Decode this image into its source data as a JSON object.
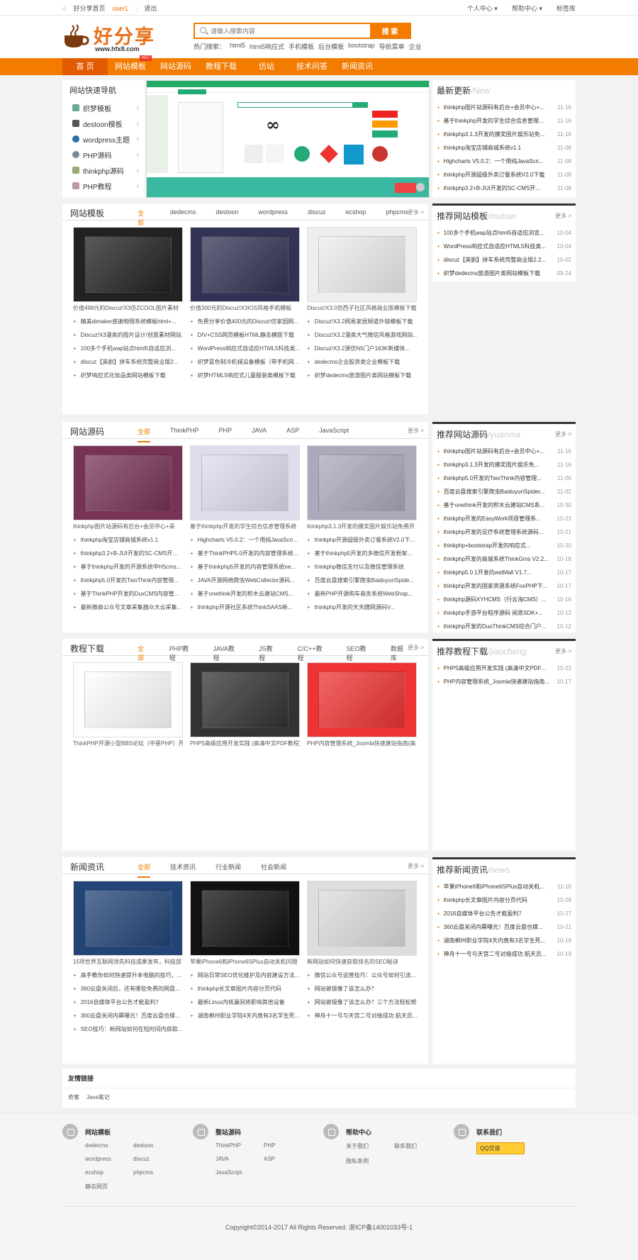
{
  "topbar": {
    "home": "好分享首页",
    "user": "user1",
    "logout": "退出",
    "personal_center": "个人中心",
    "help_center": "帮助中心",
    "bookmark": "标签库"
  },
  "logo": {
    "name": "好分享",
    "url": "www.hfx8.com"
  },
  "search": {
    "placeholder": "请输入搜索内容",
    "button": "搜 索"
  },
  "hot_search": {
    "label": "热门搜索：",
    "items": [
      "html5",
      "html5响应式",
      "手机模板",
      "后台模板",
      "bootstrap",
      "导航菜单",
      "企业"
    ]
  },
  "nav": {
    "items": [
      "首 页",
      "网站模板",
      "网站源码",
      "教程下载",
      "仿站",
      "技术问答",
      "新闻资讯"
    ],
    "hot_badge": "HOT"
  },
  "quick_nav": {
    "title": "网站快速导航",
    "items": [
      "织梦模板",
      "destoon模板",
      "wordpress主题",
      "PHP源码",
      "thinkphp源码",
      "PHP教程"
    ]
  },
  "latest": {
    "title": "最新更新",
    "en": "/New",
    "items": [
      {
        "t": "thinkphp图片站源码有后台+会员中心+...",
        "d": "11-16"
      },
      {
        "t": "基于thinkphp开发的学生综合信息管理...",
        "d": "11-16"
      },
      {
        "t": "thinkphp3.1.3开发的摸奖图片娱乐站免...",
        "d": "11-16"
      },
      {
        "t": "thinkphp淘宝店铺商城系统v1.1",
        "d": "11-08"
      },
      {
        "t": "Highcharts V5.0.2：一个用纯JavaScri...",
        "d": "11-08"
      },
      {
        "t": "thinkphp开源超级外卖订餐系统V2.0下载",
        "d": "11-08"
      },
      {
        "t": "thinkphp3.2+B-JUI开发的SC-CMS开...",
        "d": "11-08"
      }
    ]
  },
  "sections": [
    {
      "title": "网站模板",
      "tabs": [
        "全部",
        "dedecms",
        "destoon",
        "wordpress",
        "discuz",
        "ecshop",
        "phpcms"
      ],
      "more": "更多 >",
      "thumbs": [
        "价值498元的Discuz!X3仿ZCOOL图片素材",
        "价值300元的Discuz!X3IOS风格手机模板",
        "Discuz!X3.0仿西子社区风格商业版模板下载"
      ],
      "lists": [
        [
          "精美dimaker感谢物理系统模板html+...",
          "Discuz!X3漫类的图片设计/创意素材网站...",
          "100多个手机wap站点html5自适应浏...",
          "discuz【英剧】拼车系统完整商业版2...",
          "织梦响应式化妆品类网站模板下载"
        ],
        [
          "免费分享价值400元的Discuz!仿家园网...",
          "DIV+CSS网页模板HTML静态模版下载",
          "WordPress响应式自适应HTML5科技类...",
          "织梦蓝色制冷机械设备模板（带手机网...",
          "织梦HTML5响应式儿童服装类模板下载"
        ],
        [
          "Discuz!X3.2网易家居频道外链模板下载",
          "Discuz!X3.2漫类大气微信风格游戏网站...",
          "Discuz!X3.2源仿N5门户163K新媒体...",
          "dedecms企业股资类企业模板下载",
          "织梦dedecms旅游图片类网站模板下载"
        ]
      ]
    },
    {
      "title": "网站源码",
      "tabs": [
        "全部",
        "ThinkPHP",
        "PHP",
        "JAVA",
        "ASP",
        "JavaScript"
      ],
      "more": "更多 >",
      "thumbs": [
        "thinkphp图片站源码有后台+会员中心+采",
        "基于thinkphp开发的学生综合信息管理系统",
        "thinkphp3.1.3开发的摸奖图片娱乐站免费开"
      ],
      "lists": [
        [
          "thinkphp淘宝店铺商城系统v1.1",
          "thinkphp3.2+B-JUI开发的SC-CMS开...",
          "基于thinkphp开发的开源系统中H5cms...",
          "thinkphp5.0开发的TwoThink内容管理...",
          "基于ThinkPHP开发的DuxCMS内容管...",
          "最新微商公众号文章采集器众大云采集..."
        ],
        [
          "Highcharts V5.0.2：一个用纯JavaScri...",
          "基于ThinkPHP5.0开发的内容管理系统...",
          "基于thinkphp5开发的内容管理系统ne...",
          "JAVA开源网络爬虫WebCollector源码...",
          "基于onethink开发的积木云建站CMS...",
          "thinkphp开源社区系统ThinkSAAS新..."
        ],
        [
          "thinkphp开源超级外卖订餐系统V2.0下...",
          "基于thinkphp5开发的多微信开发框架...",
          "thinkphp微信支付以及微信管理系统",
          "百度云盘搜索引擎爬虫BaiduyunSpide...",
          "最新PHP开源购车商务系统WebShop...",
          "thinkphp开发的天天蹭网源码V..."
        ]
      ]
    },
    {
      "title": "教程下载",
      "tabs": [
        "全部",
        "PHP教程",
        "JAVA教程",
        "JS教程",
        "C/C++教程",
        "SEO教程",
        "数据库"
      ],
      "more": "更多 >",
      "thumbs": [
        "ThinkPHP开源小型BBS论坛（中星PHP）开",
        "PHP5高级应用开发实践 (高清中文PDF教程)",
        "PHP内容管理系统_Joomla快速建站指南(高"
      ],
      "lists": []
    },
    {
      "title": "新闻资讯",
      "tabs": [
        "全部",
        "技术资讯",
        "行业新闻",
        "社会新闻"
      ],
      "more": "更多 >",
      "thumbs": [
        "15项世界互联网领先科技成果发布，科技部",
        "苹果iPhone6和iPhone6SPlus自动关机问题",
        "新网站如何快速获取排名的SEO秘诀"
      ],
      "lists": [
        [
          "高手教你如何快速提升本电脑的技巧，...",
          "360云盘关闭后，还有哪些免费的网盘...",
          "2016自媒体平台公告才能盈利？",
          "360云盘关闭内幕曝光！百度云盘也撑...",
          "SEO技巧：新网站如何在短时间内获取..."
        ],
        [
          "网站日常SEO优化维护及内容建设方法...",
          "thinkphp长文章图片内容分页代码",
          "最新Linux内核漏洞将影响其他设备",
          "湖南郴州职业学院4天内竟有3名学生死..."
        ],
        [
          "微信公众号运营技巧：公众号如何引流...",
          "网站被镜像了该怎么办？",
          "网站被镜像了该怎么办？三个方法轻松帮...",
          "神舟十一号与天宫二号对接成功 航天员..."
        ]
      ]
    }
  ],
  "side_boxes": [
    {
      "title": "推荐网站模板",
      "en": "/muban",
      "more": "更多 >",
      "items": [
        {
          "t": "100多个手机wap站点html5自适应浏览...",
          "d": "10-04"
        },
        {
          "t": "WordPress响应式自适应HTML5科技类...",
          "d": "10-04"
        },
        {
          "t": "discuz【英剧】拼车系统完整商业版2.2...",
          "d": "10-02"
        },
        {
          "t": "织梦dedecms旅游图片类网站模板下载",
          "d": "09-24"
        }
      ]
    },
    {
      "title": "推荐网站源码",
      "en": "/yuanma",
      "more": "更多 >",
      "items": [
        {
          "t": "thinkphp图片站源码有后台+会员中心+...",
          "d": "11-16"
        },
        {
          "t": "thinkphp3.1.3开发的摸奖图片娱乐免...",
          "d": "11-16"
        },
        {
          "t": "thinkphp5.0开发的TwoThink内容管理...",
          "d": "11-06"
        },
        {
          "t": "百度云盘搜索引擎爬虫BaiduyunSpider...",
          "d": "11-02"
        },
        {
          "t": "基于onethink开发的积木云建站CMS系...",
          "d": "10-30"
        },
        {
          "t": "thinkphp开发的EasyWork项目管理系...",
          "d": "10-23"
        },
        {
          "t": "thinkphp开发的足疗系统管理系统源码...",
          "d": "10-21"
        },
        {
          "t": "thinkphp+bootstrap开发的响应式...",
          "d": "10-20"
        },
        {
          "t": "thinkphp开发的商城系统ThinkGms V2.2...",
          "d": "10-18"
        },
        {
          "t": "thinkphp5.0.1开发的wstMall V1.7...",
          "d": "10-17"
        },
        {
          "t": "thinkphp开发的国家资源系统FoxPHP下...",
          "d": "10-17"
        },
        {
          "t": "thinkphp源码XYHCMS（行云海CMS）...",
          "d": "10-16"
        },
        {
          "t": "thinkphp手游平台程序源码 阅思SDK+...",
          "d": "10-12"
        },
        {
          "t": "thinkphp开发的DuoThinkCMS综合门户...",
          "d": "10-12"
        }
      ]
    },
    {
      "title": "推荐教程下载",
      "en": "/jiaocheng",
      "more": "更多 >",
      "items": [
        {
          "t": "PHP5高级应用开发实践 (高清中文PDF...",
          "d": "10-22"
        },
        {
          "t": "PHP内容管理系统_Joomla快速建站指南...",
          "d": "10-17"
        }
      ]
    },
    {
      "title": "推荐新闻资讯",
      "en": "/news",
      "more": "",
      "items": [
        {
          "t": "苹果iPhone6和iPhone6SPlus自动关机...",
          "d": "11-16"
        },
        {
          "t": "thinkphp长文章图片内容分页代码",
          "d": "10-28"
        },
        {
          "t": "2016自媒体平台公告才能盈利？",
          "d": "10-27"
        },
        {
          "t": "360云盘关闭内幕曝光！百度云盘也撑...",
          "d": "10-21"
        },
        {
          "t": "湖南郴州职业学院4天内竟有3名学生死...",
          "d": "10-19"
        },
        {
          "t": "神舟十一号与天宫二号对接成功 航天员...",
          "d": "10-19"
        }
      ]
    }
  ],
  "friend_links": {
    "title": "友情链接",
    "items": [
      "奇客",
      "Java笔记"
    ]
  },
  "footer": {
    "cols": [
      {
        "title": "网站模板",
        "links": [
          "dedecms",
          "destoon",
          "wordpress",
          "discuz",
          "ecshop",
          "phpcms",
          "静态网页"
        ]
      },
      {
        "title": "整站源码",
        "links": [
          "ThinkPHP",
          "PHP",
          "JAVA",
          "ASP",
          "JavaScript"
        ]
      },
      {
        "title": "帮助中心",
        "links": [
          "关于我们",
          "联系我们",
          "隐私条例"
        ]
      },
      {
        "title": "联系我们",
        "links": []
      }
    ],
    "qq": "QQ交谈",
    "copyright": "Copyright©2014-2017 All Rights Reserved.   浙ICP备14001033号-1"
  },
  "colors": {
    "accent": "#f27b00",
    "nav_active": "#e35b00"
  }
}
